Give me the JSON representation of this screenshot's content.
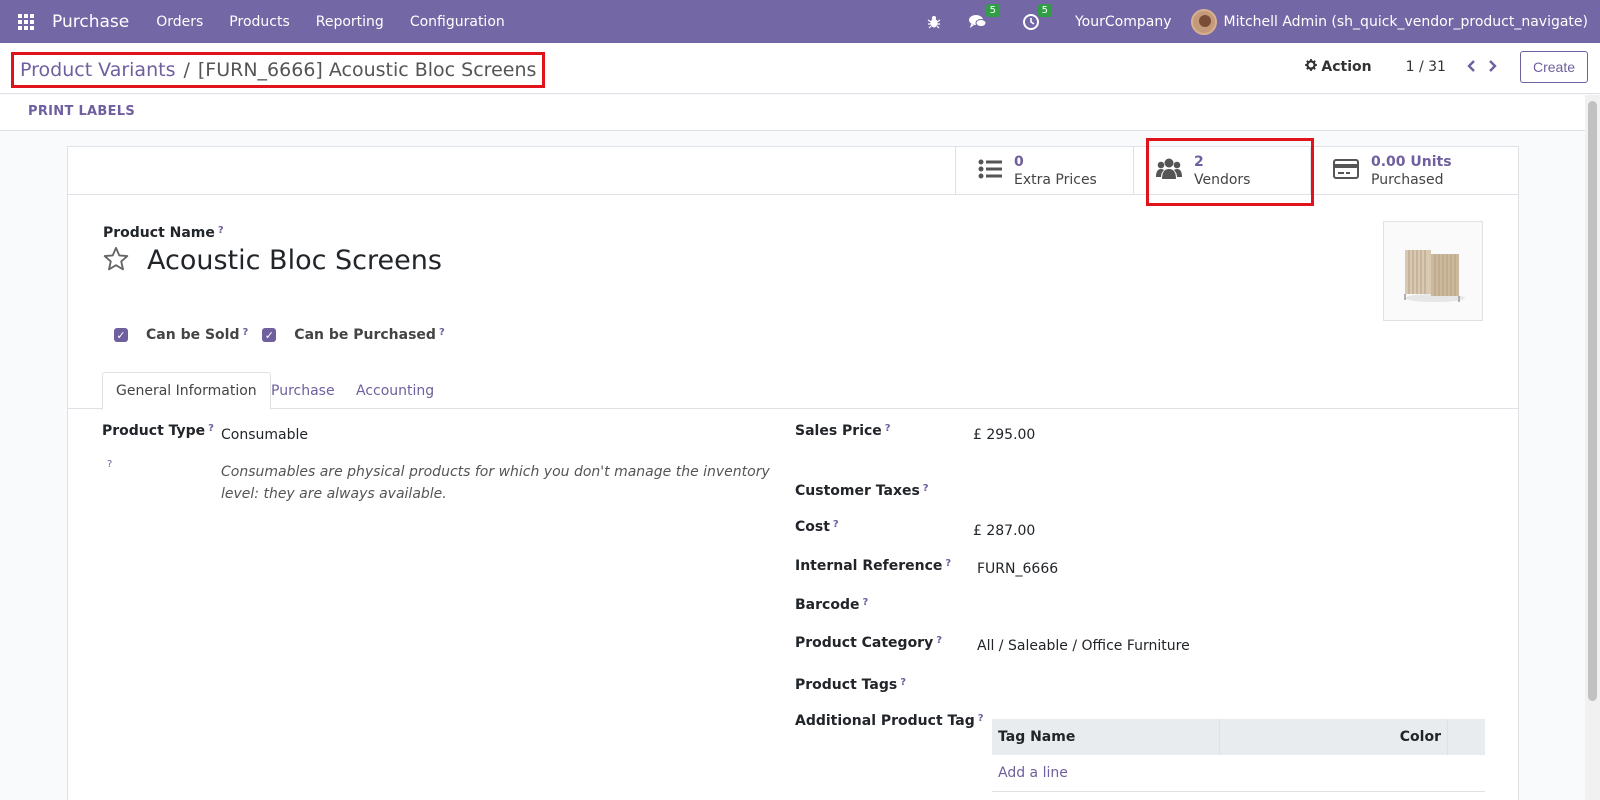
{
  "navbar": {
    "app_name": "Purchase",
    "menu": [
      "Orders",
      "Products",
      "Reporting",
      "Configuration"
    ],
    "messages_count": "5",
    "activities_count": "5",
    "company": "YourCompany",
    "user": "Mitchell Admin (sh_quick_vendor_product_navigate)"
  },
  "breadcrumb": {
    "parent": "Product Variants",
    "separator": "/",
    "current": "[FURN_6666] Acoustic Bloc Screens"
  },
  "control_panel": {
    "action_label": "Action",
    "pager": "1 / 31",
    "create_label": "Create"
  },
  "statusbar": {
    "print_labels": "PRINT LABELS"
  },
  "stat_buttons": [
    {
      "value": "0",
      "label": "Extra Prices",
      "icon": "list-icon"
    },
    {
      "value": "2",
      "label": "Vendors",
      "icon": "users-icon"
    },
    {
      "value": "0.00 Units",
      "label": "Purchased",
      "icon": "credit-card-icon"
    }
  ],
  "product": {
    "name_label": "Product Name",
    "name": "Acoustic Bloc Screens",
    "can_be_sold_label": "Can be Sold",
    "can_be_purchased_label": "Can be Purchased"
  },
  "tabs": [
    "General Information",
    "Purchase",
    "Accounting"
  ],
  "general": {
    "product_type_label": "Product Type",
    "product_type": "Consumable",
    "help_mark": "?",
    "help_text": "Consumables are physical products for which you don't manage the inventory level: they are always available.",
    "sales_price_label": "Sales Price",
    "sales_price": "£ 295.00",
    "customer_taxes_label": "Customer Taxes",
    "cost_label": "Cost",
    "cost": "£ 287.00",
    "internal_ref_label": "Internal Reference",
    "internal_ref": "FURN_6666",
    "barcode_label": "Barcode",
    "category_label": "Product Category",
    "category": "All / Saleable / Office Furniture",
    "tags_label": "Product Tags",
    "additional_tag_label": "Additional Product Tag"
  },
  "tag_table": {
    "col_name": "Tag Name",
    "col_color": "Color",
    "add_line": "Add a line"
  },
  "colors": {
    "navbar": "#7467a5",
    "accent": "#6f5f9e",
    "highlight": "#e0121b"
  }
}
